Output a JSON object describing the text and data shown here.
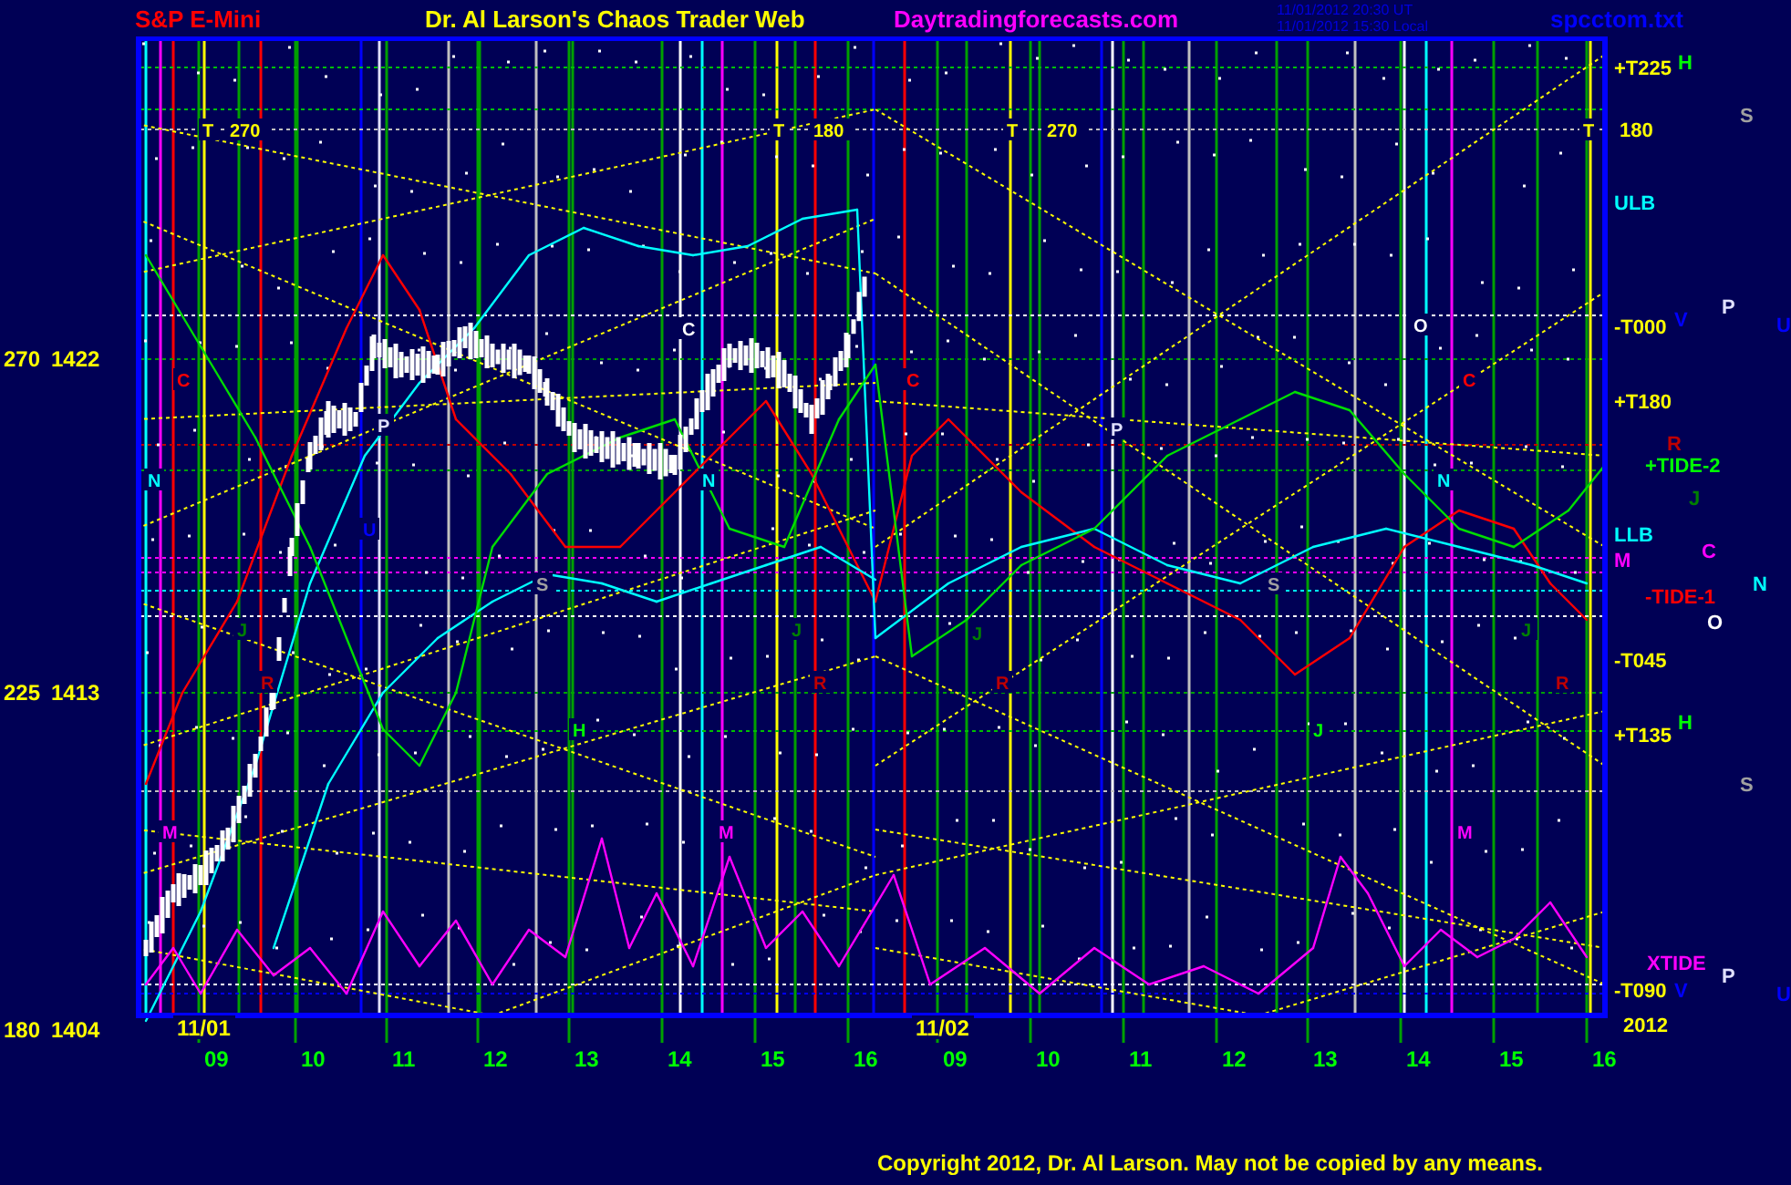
{
  "header": {
    "market": "S&P E-Mini",
    "title": "Dr. Al Larson's Chaos Trader Web",
    "site": "Daytradingforecasts.com",
    "timestamps": [
      "11/01/2012 20:30 UT",
      "11/01/2012 15:30 Local"
    ],
    "file": "spcctom.txt"
  },
  "left_axis": [
    {
      "angle": "270",
      "price": "1422"
    },
    {
      "angle": "225",
      "price": "1413"
    },
    {
      "angle": "180",
      "price": "1404"
    }
  ],
  "right_labels": [
    {
      "text": "+T225",
      "color": "#ffff00"
    },
    {
      "text": "H",
      "color": "#00ff00"
    },
    {
      "text": "180",
      "color": "#ffff00"
    },
    {
      "text": "S",
      "color": "#a0a0a0"
    },
    {
      "text": "ULB",
      "color": "#00ffff"
    },
    {
      "text": "-T000",
      "color": "#ffff00"
    },
    {
      "text": "V",
      "color": "#0000ff"
    },
    {
      "text": "P",
      "color": "#e0e0ff"
    },
    {
      "text": "U",
      "color": "#0000ff"
    },
    {
      "text": "+T180",
      "color": "#ffff00"
    },
    {
      "text": "R",
      "color": "#c00000"
    },
    {
      "text": "+TIDE-2",
      "color": "#00ff00"
    },
    {
      "text": "J",
      "color": "#008000"
    },
    {
      "text": "LLB",
      "color": "#00ffff"
    },
    {
      "text": "M",
      "color": "#ff00ff"
    },
    {
      "text": "C",
      "color": "#ff00ff"
    },
    {
      "text": "N",
      "color": "#00ffff"
    },
    {
      "text": "-TIDE-1",
      "color": "#ff0000"
    },
    {
      "text": "O",
      "color": "#ffffff"
    },
    {
      "text": "-T045",
      "color": "#ffff00"
    },
    {
      "text": "+T135",
      "color": "#ffff00"
    },
    {
      "text": "H",
      "color": "#00ff00"
    },
    {
      "text": "S",
      "color": "#a0a0a0"
    },
    {
      "text": "XTIDE",
      "color": "#ff00ff"
    },
    {
      "text": "P",
      "color": "#e0e0ff"
    },
    {
      "text": "-T090",
      "color": "#ffff00"
    },
    {
      "text": "V",
      "color": "#0000ff"
    },
    {
      "text": "U",
      "color": "#0000ff"
    },
    {
      "text": "2012",
      "color": "#ffff00"
    }
  ],
  "chart_labels": [
    {
      "text": "T",
      "color": "#ffff00"
    },
    {
      "text": "270",
      "color": "#ffff00"
    },
    {
      "text": "T",
      "color": "#ffff00"
    },
    {
      "text": "180",
      "color": "#ffff00"
    },
    {
      "text": "T",
      "color": "#ffff00"
    },
    {
      "text": "270",
      "color": "#ffff00"
    },
    {
      "text": "T",
      "color": "#ffff00"
    },
    {
      "text": "C",
      "color": "#ff0000"
    },
    {
      "text": "N",
      "color": "#00ffff"
    },
    {
      "text": "P",
      "color": "#e0e0ff"
    },
    {
      "text": "U",
      "color": "#0000ff"
    },
    {
      "text": "J",
      "color": "#008000"
    },
    {
      "text": "R",
      "color": "#c00000"
    },
    {
      "text": "M",
      "color": "#ff00ff"
    },
    {
      "text": "C",
      "color": "#ffffff"
    },
    {
      "text": "N",
      "color": "#00ffff"
    },
    {
      "text": "S",
      "color": "#a0a0a0"
    },
    {
      "text": "H",
      "color": "#00ff00"
    },
    {
      "text": "M",
      "color": "#ff00ff"
    },
    {
      "text": "C",
      "color": "#ff0000"
    },
    {
      "text": "J",
      "color": "#008000"
    },
    {
      "text": "R",
      "color": "#c00000"
    },
    {
      "text": "J",
      "color": "#008000"
    },
    {
      "text": "R",
      "color": "#c00000"
    },
    {
      "text": "P",
      "color": "#e0e0ff"
    },
    {
      "text": "O",
      "color": "#ffffff"
    },
    {
      "text": "C",
      "color": "#ff0000"
    },
    {
      "text": "N",
      "color": "#00ffff"
    },
    {
      "text": "S",
      "color": "#a0a0a0"
    },
    {
      "text": "J",
      "color": "#00ff00"
    },
    {
      "text": "M",
      "color": "#ff00ff"
    },
    {
      "text": "J",
      "color": "#008000"
    },
    {
      "text": "R",
      "color": "#c00000"
    }
  ],
  "date_labels": [
    "11/01",
    "11/02"
  ],
  "hour_labels": [
    "09",
    "10",
    "11",
    "12",
    "13",
    "14",
    "15",
    "16",
    "09",
    "10",
    "11",
    "12",
    "13",
    "14",
    "15",
    "16"
  ],
  "copyright": "Copyright 2012, Dr. Al Larson. May not be copied by any means."
}
